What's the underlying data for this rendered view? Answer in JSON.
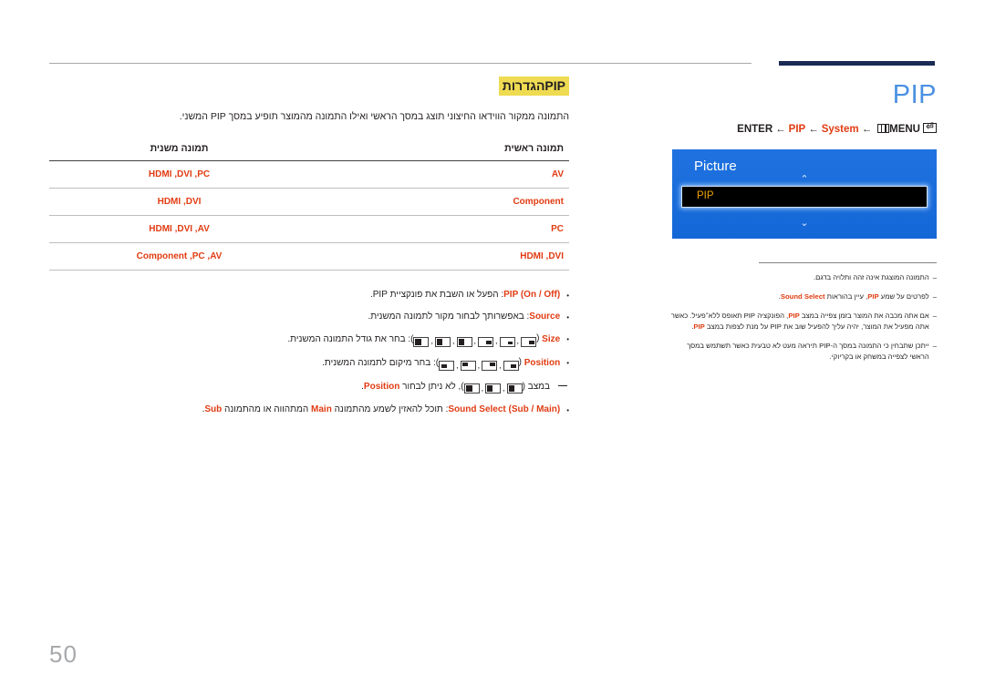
{
  "page": {
    "number": "50"
  },
  "right_panel": {
    "title": "PIP",
    "menu_path": {
      "menu_label": "MENU",
      "system_label": "System",
      "pip_label": "PIP",
      "enter_label": "ENTER",
      "arrow": "←",
      "enter_glyph": "⏎"
    },
    "osd": {
      "heading": "Picture",
      "up_chevron": "⌃",
      "down_chevron": "⌄",
      "selected_item": "PIP"
    },
    "notes": [
      {
        "dash": "–",
        "text": "התמונה המוצגת אינה זהה ותלויה בדגם."
      },
      {
        "dash": "–",
        "text_before": "לפרטים על שמע ",
        "bold1": "PIP",
        "text_middle": ", עיין בהוראות ",
        "bold2": "Sound Select",
        "text_after": "."
      },
      {
        "dash": "–",
        "text_before": "אם אתה מכבה את המוצר בזמן צפייה במצב ",
        "bold1": "PIP",
        "text_middle": ", הפונקציה PIP תאופס ללא־פעיל. כאשר אתה מפעיל את המוצר, יהיה עליך להפעיל שוב את PIP על מנת לצפות במצב ",
        "bold2": "PIP",
        "text_after": "."
      },
      {
        "dash": "–",
        "text": "ייתכן שתבחין כי התמונה במסך ה-PIP תיראה מעט לא טבעית כאשר תשתמש במסך הראשי לצפייה במשחק או בקריוקי."
      }
    ]
  },
  "main": {
    "section_title": "PIPהגדרות",
    "intro": "התמונה ממקור הווידאו החיצוני תוצג במסך הראשי ואילו התמונה מהמוצר תופיע במסך PIP המשני.",
    "table": {
      "headers": {
        "main_picture": "תמונה ראשית",
        "sub_picture": "תמונה משנית"
      },
      "rows": [
        {
          "main": "AV",
          "sub": "HDMI ,DVI ,PC"
        },
        {
          "main": "Component",
          "sub": "HDMI ,DVI"
        },
        {
          "main": "PC",
          "sub": "HDMI ,DVI ,AV"
        },
        {
          "main": "HDMI ,DVI",
          "sub": "Component ,PC ,AV"
        }
      ]
    },
    "bullets": [
      {
        "bullet": "•",
        "bold": "PIP (On / Off)",
        "text": ": הפעל או השבת את פונקציית PIP."
      },
      {
        "bullet": "•",
        "bold": "Source",
        "text": ": באפשרותך לבחור מקור לתמונה המשנית."
      },
      {
        "bullet": "•",
        "bold": "Size",
        "text_before": " (",
        "text_after": "): בחר את גודל התמונה המשנית.",
        "glyph_count": 6
      },
      {
        "bullet": "•",
        "bold": "Position",
        "text_before": " (",
        "text_after": "): בחר מיקום לתמונה המשנית.",
        "glyph_count": 4
      },
      {
        "bullet": "",
        "text_before": " במצב (",
        "text_after": "), לא ניתן לבחור ",
        "bold": "Position",
        "text_end": ".",
        "glyph_count": 3
      },
      {
        "bullet": "•",
        "bold": "Sound Select (Sub / Main)",
        "text_before": ": תוכל להאזין לשמע מהתמונה ",
        "bold2": "Main",
        "text_middle": " המתהווה או מהתמונה ",
        "bold3": "Sub",
        "text_after": "."
      }
    ]
  }
}
